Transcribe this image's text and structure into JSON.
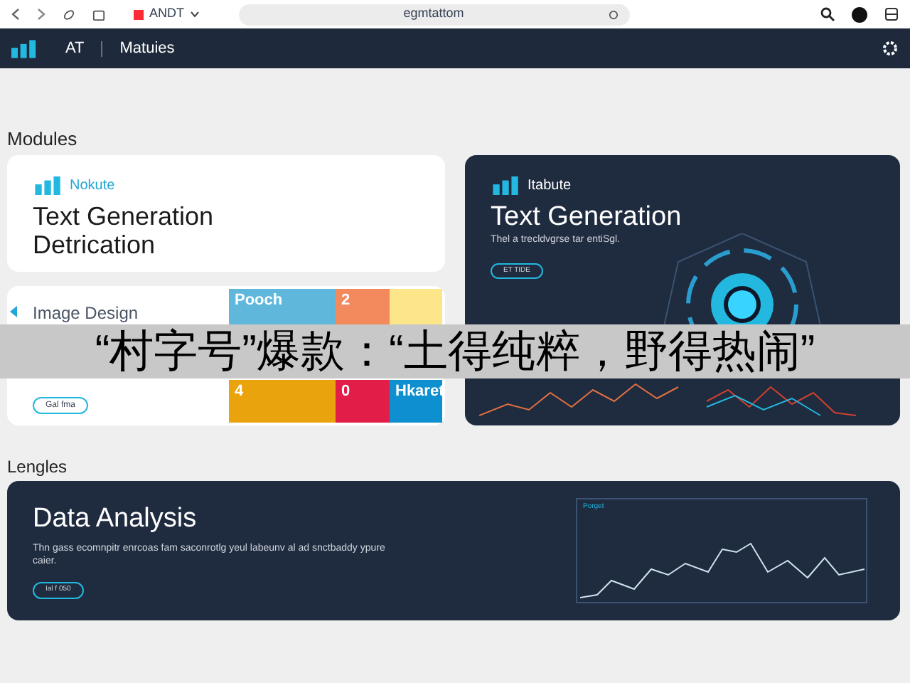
{
  "browser": {
    "profile": "ANDT",
    "address": "egmtattom"
  },
  "app_bar": {
    "brand": "AT",
    "section": "Matuies"
  },
  "sections": [
    {
      "title": "Modules"
    },
    {
      "title": "Lengles"
    }
  ],
  "cards": [
    {
      "kind": "light",
      "brand": "Nokute",
      "title": "Text Generation",
      "subtitle": "Detrication"
    },
    {
      "kind": "dark",
      "brand": "Itabute",
      "title": "Text Generation",
      "body": "Thel a trecldvgrse tar entiSgl.",
      "button": "ET TIDE"
    },
    {
      "kind": "image",
      "title": "Image Design",
      "button": "Gal fma",
      "tiles": [
        {
          "label": "Pooch",
          "color": "#5fb8dc"
        },
        {
          "label": "2",
          "color": "#f28a5e"
        },
        {
          "color": "#fde68a"
        },
        {
          "label": "4",
          "color": "#e9a30c"
        },
        {
          "label": "0",
          "color": "#e11d48"
        },
        {
          "label": "Hkaret",
          "color": "#0e8fcf"
        }
      ]
    }
  ],
  "analysis": {
    "title": "Data Analysis",
    "body": "Thn gass ecomnpitr enrcoas fam saconrotlg yeul labeunv al ad snctbaddy ypure caier.",
    "button": "Ial f 050",
    "chart_title": "Porget"
  },
  "caption": "“村字号”爆款：“土得纯粹，野得热闹”"
}
